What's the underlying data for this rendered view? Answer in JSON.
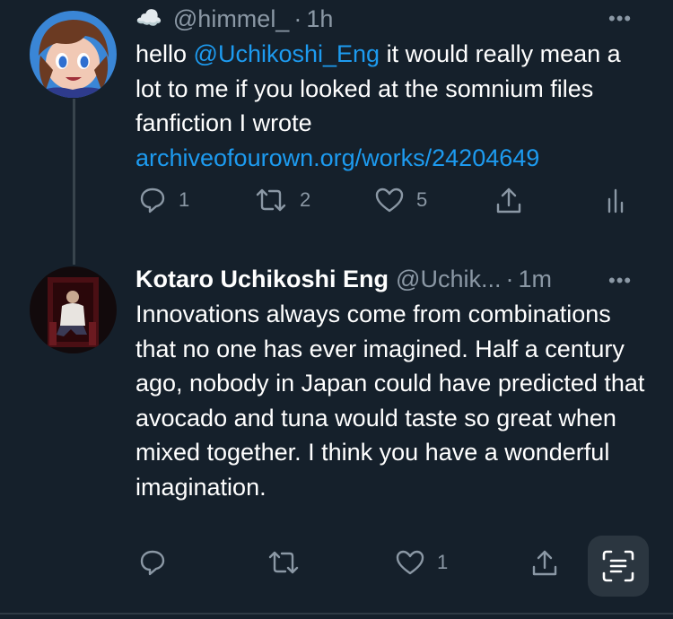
{
  "tweet1": {
    "emoji": "☁️",
    "handle": "@himmel_",
    "sep": "·",
    "time": "1h",
    "text_before": "hello ",
    "mention": "@Uchikoshi_Eng",
    "text_after": " it would really mean a lot to me if you looked at the somnium files fanfiction I wrote",
    "link": "archiveofourown.org/works/24204649",
    "more": "•••",
    "actions": {
      "reply_count": "1",
      "retweet_count": "2",
      "like_count": "5"
    }
  },
  "tweet2": {
    "name": "Kotaro Uchikoshi Eng",
    "handle": "@Uchik...",
    "sep": "·",
    "time": "1m",
    "more": "•••",
    "text": "Innovations always come from combinations that no one has ever imagined. Half a century ago, nobody in Japan could have predicted that avocado and tuna would taste so great when mixed together. I think you have a wonderful imagination.",
    "actions": {
      "like_count": "1"
    }
  },
  "colors": {
    "background": "#15202b",
    "link": "#1d9bf0",
    "muted": "#8b98a5"
  },
  "icons": [
    "reply-icon",
    "retweet-icon",
    "like-icon",
    "share-icon",
    "analytics-icon",
    "text-scan-icon",
    "more-icon"
  ]
}
